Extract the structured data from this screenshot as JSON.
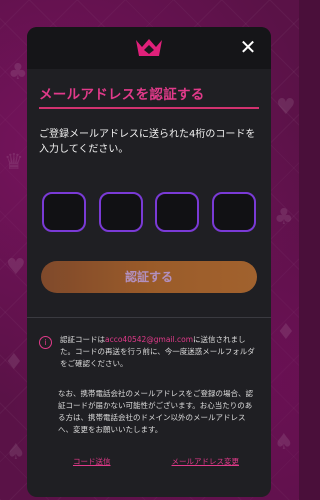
{
  "modal": {
    "close_label": "✕",
    "title": "メールアドレスを認証する",
    "description": "ご登録メールアドレスに送られた4桁のコードを入力してください。",
    "code_digits": [
      "",
      "",
      "",
      ""
    ],
    "verify_label": "認証する",
    "info_prefix": "認証コードは",
    "info_email": "acco40542@gmail.com",
    "info_suffix": "に送信されました。コードの再送を行う前に、今一度迷惑メールフォルダをご確認ください。",
    "note": "なお、携帯電話会社のメールアドレスをご登録の場合、認証コードが届かない可能性がございます。お心当たりのある方は、携帯電話会社のドメイン以外のメールアドレスへ、変更をお願いいたします。",
    "resend_label": "コード送信",
    "change_email_label": "メールアドレス変更"
  },
  "colors": {
    "accent": "#e13a8a",
    "input_border": "#7a3ad6",
    "button_gradient_start": "#8a4e2c",
    "button_gradient_end": "#b06a30",
    "modal_background": "#1f1f23"
  },
  "icons": {
    "logo": "crown-logo-icon",
    "close": "close-icon",
    "info": "info-icon"
  }
}
